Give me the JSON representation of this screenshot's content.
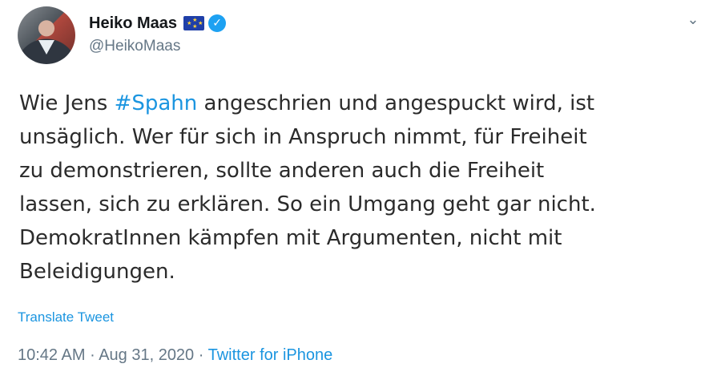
{
  "author": {
    "name": "Heiko Maas",
    "handle": "@HeikoMaas"
  },
  "tweet": {
    "text_before_hashtag": "Wie Jens ",
    "hashtag": "#Spahn",
    "line1_rest": " angeschrien und angespuckt wird, ist",
    "line2": "unsäglich. Wer für sich in Anspruch nimmt, für Freiheit",
    "line3": "zu demonstrieren, sollte anderen auch die Freiheit",
    "line4": "lassen, sich zu erklären. So ein Umgang geht gar nicht.",
    "line5": "DemokratInnen kämpfen mit Argumenten, nicht mit",
    "line6": "Beleidigungen.",
    "translate_label": "Translate Tweet"
  },
  "meta": {
    "time": "10:42 AM",
    "sep1": " · ",
    "date": "Aug 31, 2020",
    "sep2": " · ",
    "source": "Twitter for iPhone"
  },
  "icons": {
    "verified": "verified-badge-icon",
    "flag": "eu-flag-icon",
    "menu": "chevron-down-icon"
  },
  "colors": {
    "link": "#1b95e0",
    "muted": "#657786",
    "verified": "#1da1f2"
  }
}
